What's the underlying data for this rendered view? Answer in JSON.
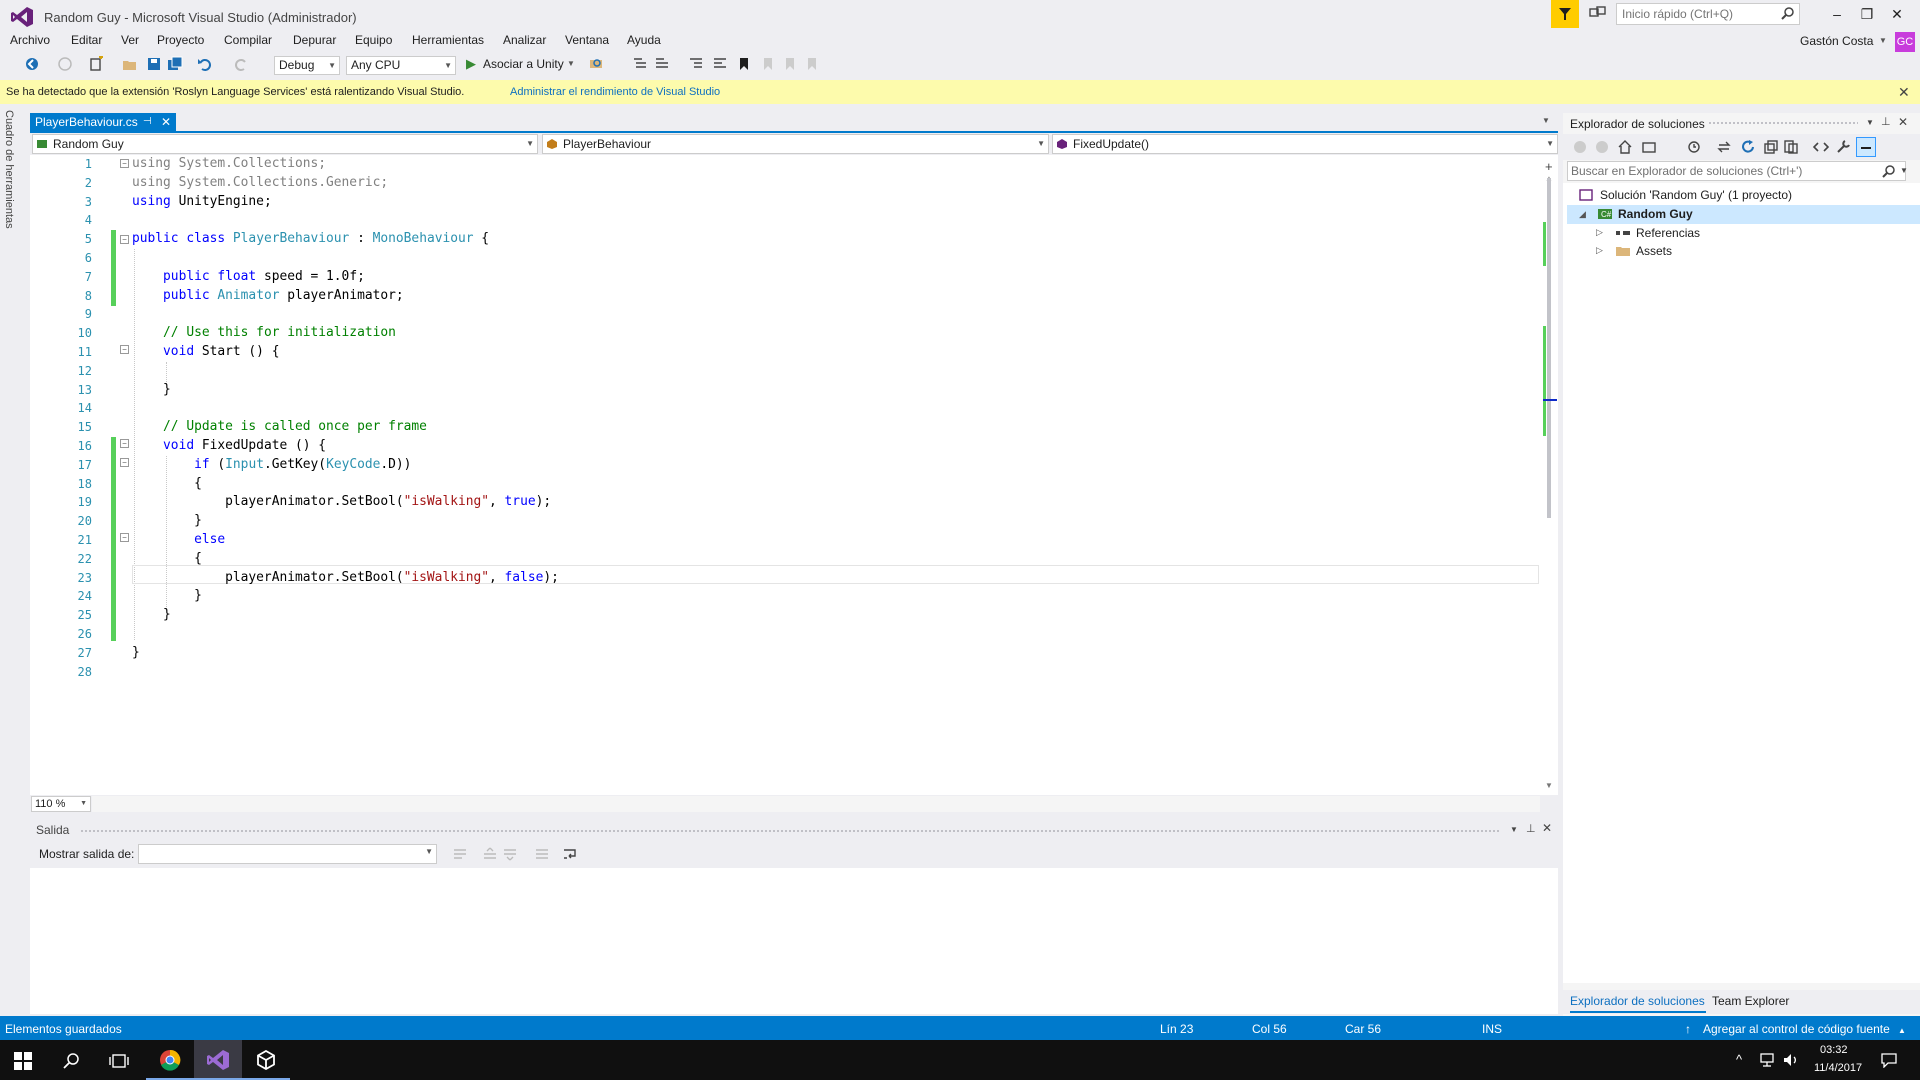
{
  "window": {
    "title": "Random Guy - Microsoft Visual Studio (Administrador)",
    "quick_launch_placeholder": "Inicio rápido (Ctrl+Q)",
    "minimize": "–",
    "maximize": "❐",
    "close": "✕"
  },
  "menu": [
    "Archivo",
    "Editar",
    "Ver",
    "Proyecto",
    "Compilar",
    "Depurar",
    "Equipo",
    "Herramientas",
    "Analizar",
    "Ventana",
    "Ayuda"
  ],
  "user": {
    "name": "Gastón Costa",
    "initials": "GC"
  },
  "toolbar": {
    "config": "Debug",
    "platform": "Any CPU",
    "attach": "Asociar a Unity"
  },
  "infobar": {
    "message": "Se ha detectado que la extensión 'Roslyn Language Services' está ralentizando Visual Studio.",
    "link": "Administrar el rendimiento de Visual Studio"
  },
  "toolbox_label": "Cuadro de herramientas",
  "editor": {
    "tab": "PlayerBehaviour.cs",
    "nav_project": "Random Guy",
    "nav_class": "PlayerBehaviour",
    "nav_member": "FixedUpdate()",
    "zoom": "110 %",
    "line_numbers": [
      "1",
      "2",
      "3",
      "4",
      "5",
      "6",
      "7",
      "8",
      "9",
      "10",
      "11",
      "12",
      "13",
      "14",
      "15",
      "16",
      "17",
      "18",
      "19",
      "20",
      "21",
      "22",
      "23",
      "24",
      "25",
      "26",
      "27",
      "28"
    ]
  },
  "output": {
    "title": "Salida",
    "show_label": "Mostrar salida de:"
  },
  "solution_explorer": {
    "title": "Explorador de soluciones",
    "search_placeholder": "Buscar en Explorador de soluciones (Ctrl+')",
    "solution": "Solución 'Random Guy' (1 proyecto)",
    "project": "Random Guy",
    "references": "Referencias",
    "assets": "Assets",
    "tab_solution": "Explorador de soluciones",
    "tab_team": "Team Explorer"
  },
  "status": {
    "message": "Elementos guardados",
    "line": "Lín 23",
    "col": "Col 56",
    "car": "Car 56",
    "mode": "INS",
    "source_control": "Agregar al control de código fuente"
  },
  "taskbar": {
    "time": "03:32",
    "date": "11/4/2017"
  },
  "colors": {
    "accent": "#007acc",
    "infobar": "#fdfbac",
    "change_bar": "#57d05a",
    "keyword": "#0000ff",
    "type": "#2b91af",
    "comment": "#008000",
    "string": "#a31515"
  }
}
